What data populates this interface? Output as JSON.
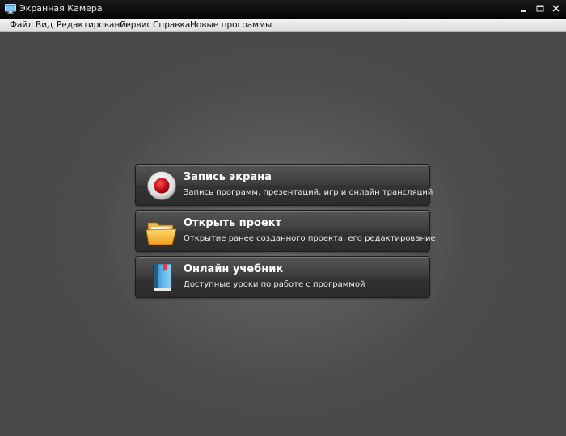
{
  "window": {
    "title": "Экранная Камера"
  },
  "menu": {
    "items": [
      "Файл",
      "Вид",
      "Редактирование",
      "Сервис",
      "Справка",
      "Новые программы"
    ]
  },
  "actions": [
    {
      "title": "Запись экрана",
      "description": "Запись программ, презентаций, игр и онлайн трансляций",
      "icon": "record-icon"
    },
    {
      "title": "Открыть проект",
      "description": "Открытие ранее созданного проекта, его редактирование",
      "icon": "folder-icon"
    },
    {
      "title": "Онлайн учебник",
      "description": "Доступные уроки по работе с программой",
      "icon": "book-icon"
    }
  ],
  "colors": {
    "background": "#4b4b4b",
    "titlebar": "#0a0a0a",
    "menubar": "#e8e8e8",
    "record_red": "#c0101a",
    "folder_orange": "#f0a020",
    "book_blue": "#5ab4e6"
  }
}
